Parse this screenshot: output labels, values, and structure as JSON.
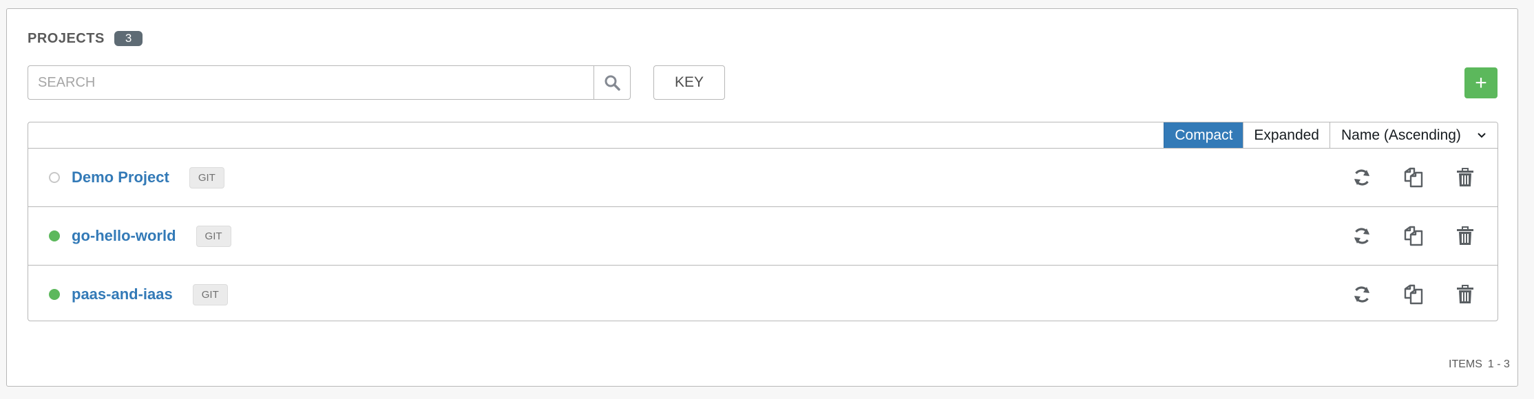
{
  "header": {
    "title": "PROJECTS",
    "count": "3"
  },
  "search": {
    "placeholder": "SEARCH",
    "value": "",
    "icon": "search-icon"
  },
  "toolbar": {
    "key_label": "KEY",
    "add_label": "+"
  },
  "view": {
    "compact_label": "Compact",
    "expanded_label": "Expanded",
    "active": "Compact",
    "sort_label": "Name (Ascending)"
  },
  "projects": [
    {
      "name": "Demo Project",
      "scm": "GIT",
      "status": "never-updated"
    },
    {
      "name": "go-hello-world",
      "scm": "GIT",
      "status": "successful"
    },
    {
      "name": "paas-and-iaas",
      "scm": "GIT",
      "status": "successful"
    }
  ],
  "row_actions": [
    "sync-icon",
    "copy-icon",
    "trash-icon"
  ],
  "pagination": {
    "label": "ITEMS",
    "range": "1 - 3"
  },
  "colors": {
    "accent": "#337ab7",
    "success": "#5cb85c",
    "badge": "#5e6b74"
  }
}
